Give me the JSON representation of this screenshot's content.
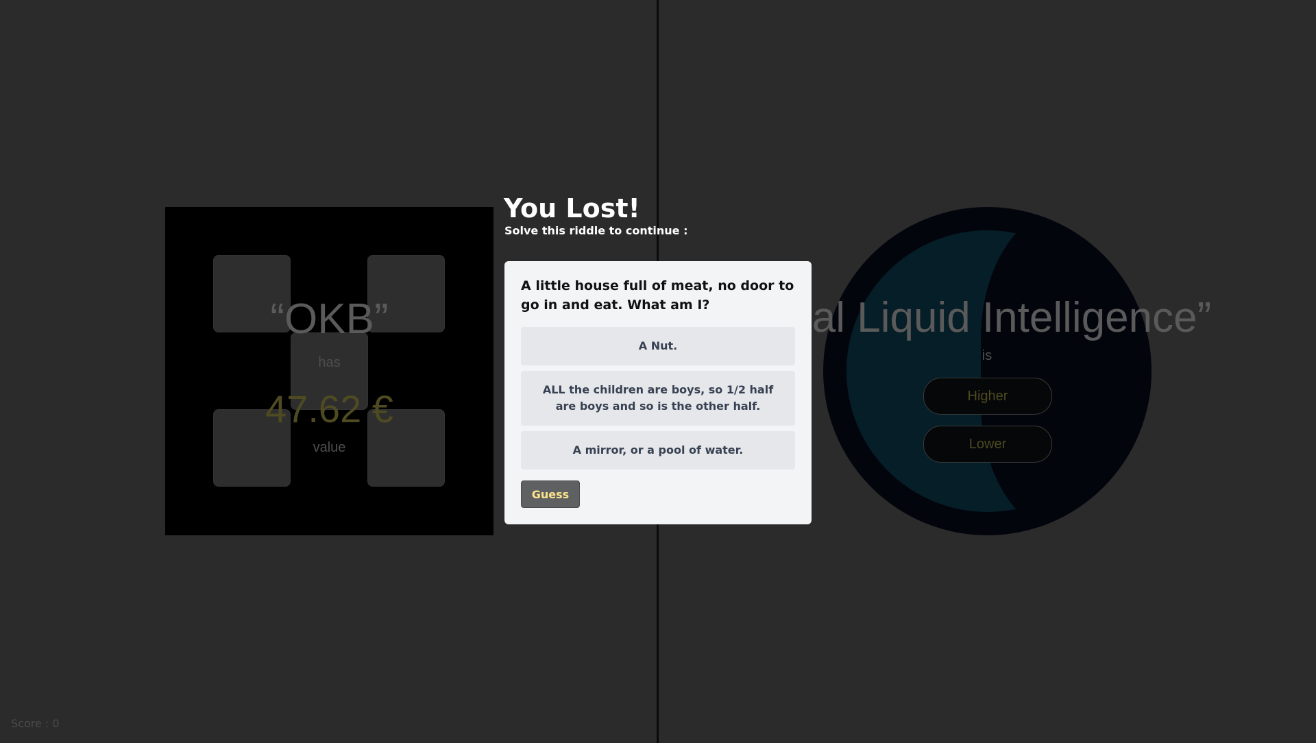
{
  "left_card": {
    "name": "“OKB”",
    "verb": "has",
    "value": "47.62 €",
    "suffix": "value"
  },
  "right_card": {
    "name": "cial Liquid Intelligence”",
    "verb": "is",
    "higher_label": "Higher",
    "lower_label": "Lower"
  },
  "score_text": "Score : 0",
  "modal": {
    "title": "You Lost!",
    "subtitle": "Solve this riddle to continue :",
    "question": "A little house full of meat, no door to go in and eat. What am I?",
    "options": [
      "A Nut.",
      "ALL the children are boys, so 1/2 half are boys and so is the other half.",
      "A mirror, or a pool of water."
    ],
    "guess_label": "Guess"
  },
  "colors": {
    "accent": "#fde68a",
    "value": "#4e4a22",
    "modal_bg": "#f3f4f6",
    "option_bg": "#e5e7eb"
  }
}
